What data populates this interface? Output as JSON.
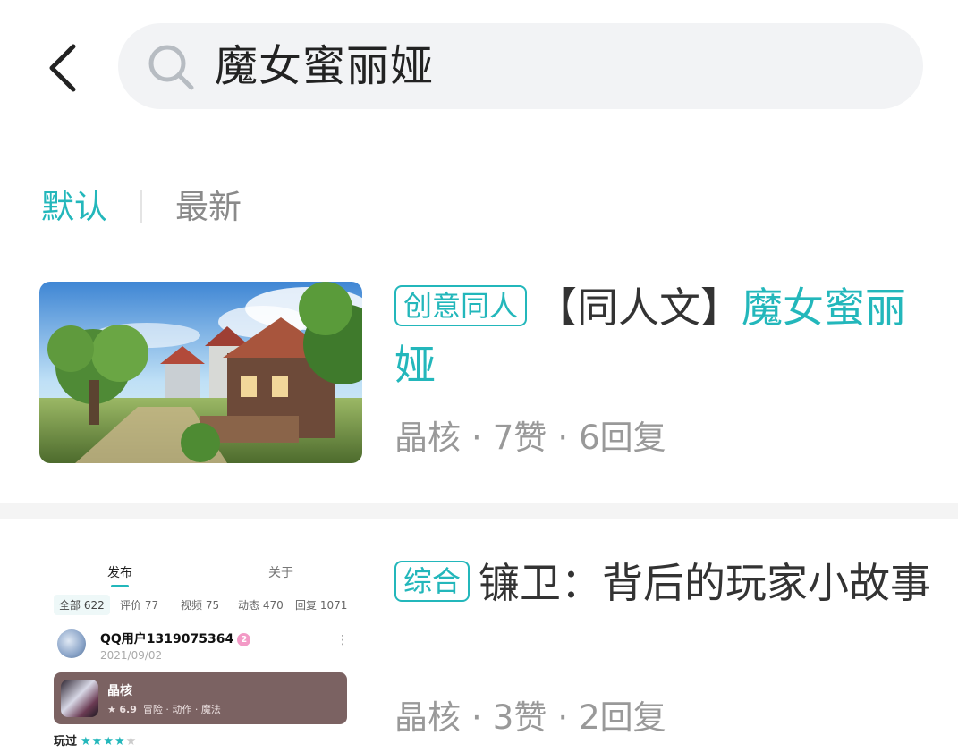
{
  "search": {
    "query": "魔女蜜丽娅"
  },
  "sort_tabs": [
    {
      "label": "默认",
      "active": true
    },
    {
      "label": "最新",
      "active": false
    }
  ],
  "colors": {
    "accent": "#23b7bb",
    "meta_text": "#999999",
    "search_bg": "#f2f3f5"
  },
  "results": [
    {
      "tag": "创意同人",
      "title_prefix": "【同人文】",
      "title_highlight": "魔女蜜丽娅",
      "title_rest": "",
      "meta": {
        "source": "晶核",
        "likes": "7赞",
        "replies": "6回复"
      },
      "thumbnail": {
        "kind": "image",
        "description_icon": "landscape-image"
      }
    },
    {
      "tag": "综合",
      "title_prefix": "",
      "title_highlight": "",
      "title_rest": "镰卫：背后的玩家小故事",
      "meta": {
        "source": "晶核",
        "likes": "3赞",
        "replies": "2回复"
      },
      "thumbnail": {
        "kind": "screenshot",
        "tabs": [
          "发布",
          "关于"
        ],
        "filters": [
          "全部 622",
          "评价 77",
          "视频 75",
          "动态 470",
          "回复 1071"
        ],
        "user_name": "QQ用户1319075364",
        "user_badge": "2",
        "date": "2021/09/02",
        "more": "⋮",
        "game_name": "晶核",
        "game_rating": "6.9",
        "game_genres": "冒险 · 动作 · 魔法",
        "played_label": "玩过",
        "stars": 4
      }
    }
  ]
}
